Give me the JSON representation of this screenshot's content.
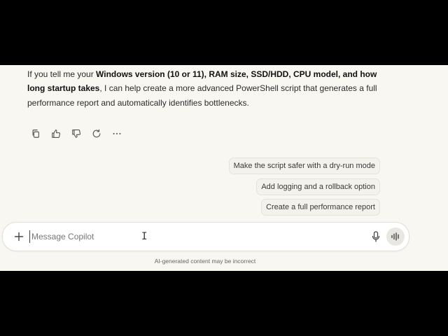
{
  "message": {
    "p1": "If you tell me your ",
    "b1": "Windows version (10 or 11), RAM size, SSD/HDD, CPU model, and how long startup takes",
    "p2": ", I can help create a more advanced PowerShell script that generates a full performance report and automatically identifies bottlenecks."
  },
  "actions": [
    {
      "icon": "copy-icon"
    },
    {
      "icon": "thumbs-up-icon"
    },
    {
      "icon": "thumbs-down-icon"
    },
    {
      "icon": "regenerate-icon"
    },
    {
      "icon": "more-icon"
    }
  ],
  "suggestions": [
    {
      "label": "Make the script safer with a dry-run mode"
    },
    {
      "label": "Add logging and a rollback option"
    },
    {
      "label": "Create a full performance report"
    }
  ],
  "composer": {
    "placeholder": "Message Copilot",
    "value": ""
  },
  "disclaimer": "AI-generated content may be incorrect",
  "colors": {
    "background": "#f8f7f2",
    "chip_background": "#f3f2ec",
    "text": "#2b2b2b",
    "letterbox": "#000000"
  }
}
